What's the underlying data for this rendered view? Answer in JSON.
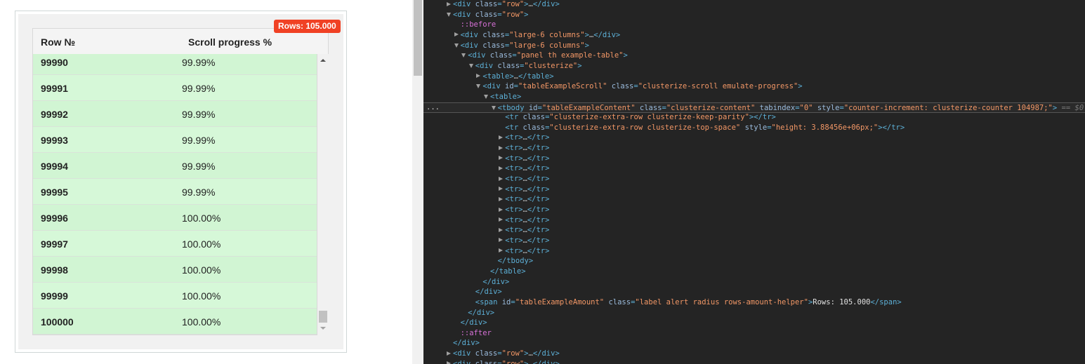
{
  "table": {
    "badge": "Rows: 105.000",
    "headers": [
      "Row №",
      "Scroll progress %"
    ],
    "rows": [
      {
        "n": "99990",
        "p": "99.99%"
      },
      {
        "n": "99991",
        "p": "99.99%"
      },
      {
        "n": "99992",
        "p": "99.99%"
      },
      {
        "n": "99993",
        "p": "99.99%"
      },
      {
        "n": "99994",
        "p": "99.99%"
      },
      {
        "n": "99995",
        "p": "99.99%"
      },
      {
        "n": "99996",
        "p": "100.00%"
      },
      {
        "n": "99997",
        "p": "100.00%"
      },
      {
        "n": "99998",
        "p": "100.00%"
      },
      {
        "n": "99999",
        "p": "100.00%"
      },
      {
        "n": "100000",
        "p": "100.00%"
      }
    ]
  },
  "devtools": {
    "selected_suffix": "== $0",
    "lines": [
      {
        "level": 0,
        "arrow": "closed",
        "text": "<div class=\"row\">…</div>"
      },
      {
        "level": 0,
        "arrow": "open",
        "text": "<div class=\"row\">"
      },
      {
        "level": 1,
        "arrow": "",
        "text": "::before"
      },
      {
        "level": 1,
        "arrow": "closed",
        "text": "<div class=\"large-6 columns\">…</div>"
      },
      {
        "level": 1,
        "arrow": "open",
        "text": "<div class=\"large-6 columns\">"
      },
      {
        "level": 2,
        "arrow": "open",
        "text": "<div class=\"panel th example-table\">"
      },
      {
        "level": 3,
        "arrow": "open",
        "text": "<div class=\"clusterize\">"
      },
      {
        "level": 4,
        "arrow": "closed",
        "text": "<table>…</table>"
      },
      {
        "level": 4,
        "arrow": "open",
        "text": "<div id=\"tableExampleScroll\" class=\"clusterize-scroll emulate-progress\">"
      },
      {
        "level": 5,
        "arrow": "open",
        "text": "<table>"
      },
      {
        "level": 6,
        "arrow": "open",
        "selected": true,
        "text": "<tbody id=\"tableExampleContent\" class=\"clusterize-content\" tabindex=\"0\" style=\"counter-increment: clusterize-counter 104987;\">"
      },
      {
        "level": 7,
        "arrow": "",
        "text": "<tr class=\"clusterize-extra-row clusterize-keep-parity\"></tr>"
      },
      {
        "level": 7,
        "arrow": "",
        "text": "<tr class=\"clusterize-extra-row clusterize-top-space\" style=\"height: 3.88456e+06px;\"></tr>"
      },
      {
        "level": 7,
        "arrow": "closed",
        "text": "<tr>…</tr>"
      },
      {
        "level": 7,
        "arrow": "closed",
        "text": "<tr>…</tr>"
      },
      {
        "level": 7,
        "arrow": "closed",
        "text": "<tr>…</tr>"
      },
      {
        "level": 7,
        "arrow": "closed",
        "text": "<tr>…</tr>"
      },
      {
        "level": 7,
        "arrow": "closed",
        "text": "<tr>…</tr>"
      },
      {
        "level": 7,
        "arrow": "closed",
        "text": "<tr>…</tr>"
      },
      {
        "level": 7,
        "arrow": "closed",
        "text": "<tr>…</tr>"
      },
      {
        "level": 7,
        "arrow": "closed",
        "text": "<tr>…</tr>"
      },
      {
        "level": 7,
        "arrow": "closed",
        "text": "<tr>…</tr>"
      },
      {
        "level": 7,
        "arrow": "closed",
        "text": "<tr>…</tr>"
      },
      {
        "level": 7,
        "arrow": "closed",
        "text": "<tr>…</tr>"
      },
      {
        "level": 7,
        "arrow": "closed",
        "text": "<tr>…</tr>"
      },
      {
        "level": 6,
        "arrow": "",
        "text": "</tbody>"
      },
      {
        "level": 5,
        "arrow": "",
        "text": "</table>"
      },
      {
        "level": 4,
        "arrow": "",
        "text": "</div>"
      },
      {
        "level": 3,
        "arrow": "",
        "text": "</div>"
      },
      {
        "level": 3,
        "arrow": "",
        "text": "<span id=\"tableExampleAmount\" class=\"label alert radius rows-amount-helper\">Rows: 105.000</span>"
      },
      {
        "level": 2,
        "arrow": "",
        "text": "</div>"
      },
      {
        "level": 1,
        "arrow": "",
        "text": "</div>"
      },
      {
        "level": 1,
        "arrow": "",
        "text": "::after"
      },
      {
        "level": 0,
        "arrow": "",
        "text": "</div>"
      },
      {
        "level": 0,
        "arrow": "closed",
        "text": "<div class=\"row\">…</div>"
      },
      {
        "level": 0,
        "arrow": "closed",
        "text": "<div class=\"row\">…</div>"
      }
    ]
  }
}
